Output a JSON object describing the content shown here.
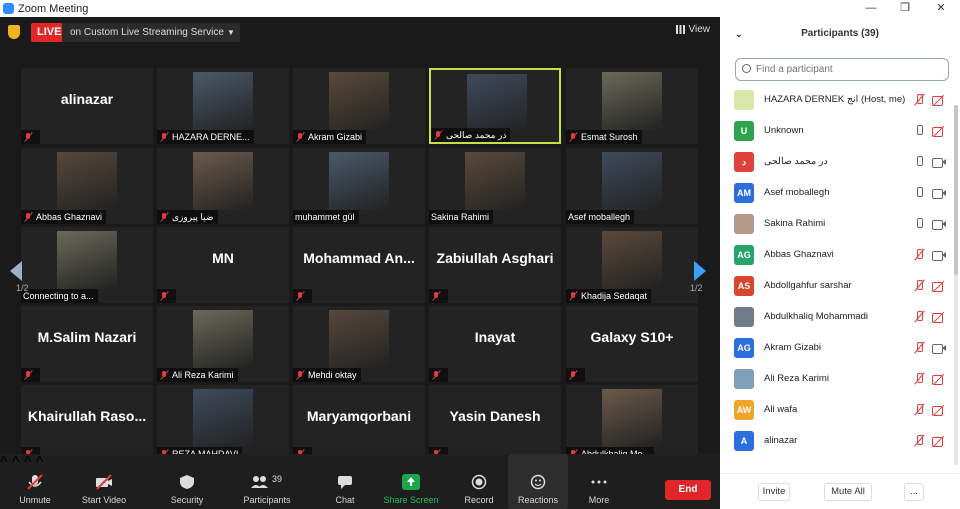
{
  "window": {
    "title": "Zoom Meeting",
    "controls": [
      "—",
      "❐",
      "✕"
    ]
  },
  "topbar": {
    "live_badge": "LIVE",
    "live_service": "on Custom Live Streaming Service",
    "view_label": "View"
  },
  "pages": {
    "left": "1/2",
    "right": "1/2"
  },
  "tiles": [
    {
      "name": "alinazar",
      "type": "text",
      "muted": true
    },
    {
      "name": "HAZARA DERNE...",
      "type": "video",
      "muted": true
    },
    {
      "name": "Akram Gizabi",
      "type": "video",
      "muted": true
    },
    {
      "name": "در محمد صالحی",
      "type": "video",
      "muted": true,
      "active": true
    },
    {
      "name": "Esmat Surosh",
      "type": "video",
      "muted": true
    },
    {
      "name": "Abbas Ghaznavi",
      "type": "video",
      "muted": true
    },
    {
      "name": "ضیا پیروزی",
      "type": "video",
      "muted": true
    },
    {
      "name": "muhammet gül",
      "type": "video",
      "muted": false
    },
    {
      "name": "Sakina Rahimi",
      "type": "video",
      "muted": false
    },
    {
      "name": "Asef moballegh",
      "type": "video",
      "muted": false
    },
    {
      "name": "Connecting to a...",
      "type": "video",
      "muted": false
    },
    {
      "name": "MN",
      "type": "text",
      "muted": true
    },
    {
      "name": "Mohammad  An...",
      "type": "text",
      "muted": true
    },
    {
      "name": "Zabiullah Asghari",
      "type": "text",
      "muted": true
    },
    {
      "name": "Khadija Sedaqat",
      "type": "video",
      "muted": true
    },
    {
      "name": "M.Salim Nazari",
      "type": "text",
      "muted": true
    },
    {
      "name": "Ali Reza Karimi",
      "type": "video",
      "muted": true
    },
    {
      "name": "Mehdi oktay",
      "type": "video",
      "muted": true
    },
    {
      "name": "Inayat",
      "type": "text",
      "muted": true
    },
    {
      "name": "Galaxy S10+",
      "type": "text",
      "muted": true
    },
    {
      "name": "Khairullah  Raso...",
      "type": "text",
      "muted": true
    },
    {
      "name": "REZA MAHDAVI",
      "type": "video",
      "muted": true
    },
    {
      "name": "Maryamqorbani",
      "type": "text",
      "muted": true
    },
    {
      "name": "Yasin Danesh",
      "type": "text",
      "muted": true
    },
    {
      "name": "Abdulkhaliq Mo...",
      "type": "video",
      "muted": true
    }
  ],
  "toolbar": {
    "unmute": "Unmute",
    "start_video": "Start Video",
    "security": "Security",
    "participants": "Participants",
    "participants_count": "39",
    "chat": "Chat",
    "share_screen": "Share Screen",
    "record": "Record",
    "reactions": "Reactions",
    "more": "More",
    "end": "End"
  },
  "panel": {
    "title": "Participants (39)",
    "search_placeholder": "Find a participant",
    "participants": [
      {
        "initials": "",
        "name": "HAZARA DERNEK انج (Host, me)",
        "color": "#dbe7a8",
        "mic": "off",
        "cam": "off"
      },
      {
        "initials": "U",
        "name": "Unknown",
        "color": "#2ea44f",
        "mic": "on",
        "cam": "off"
      },
      {
        "initials": "د",
        "name": "در محمد صالحی",
        "color": "#e0423a",
        "mic": "on",
        "cam": "on"
      },
      {
        "initials": "AM",
        "name": "Asef moballegh",
        "color": "#2a6fdb",
        "mic": "on",
        "cam": "on"
      },
      {
        "initials": "",
        "name": "Sakina Rahimi",
        "color": "#b59a8a",
        "mic": "on",
        "cam": "on"
      },
      {
        "initials": "AG",
        "name": "Abbas Ghaznavi",
        "color": "#27a36b",
        "mic": "off",
        "cam": "on"
      },
      {
        "initials": "AS",
        "name": "Abdollgahfur sarshar",
        "color": "#d9462f",
        "mic": "off",
        "cam": "off"
      },
      {
        "initials": "",
        "name": "Abdulkhaliq Mohammadi",
        "color": "#6f7c8a",
        "mic": "off",
        "cam": "off"
      },
      {
        "initials": "AG",
        "name": "Akram Gizabi",
        "color": "#2a6fdb",
        "mic": "off",
        "cam": "on"
      },
      {
        "initials": "",
        "name": "Ali Reza Karimi",
        "color": "#7ea0b8",
        "mic": "off",
        "cam": "off"
      },
      {
        "initials": "AW",
        "name": "Ali wafa",
        "color": "#f0a42a",
        "mic": "off",
        "cam": "off"
      },
      {
        "initials": "A",
        "name": "alinazar",
        "color": "#2a6fdb",
        "mic": "off",
        "cam": "off"
      }
    ],
    "invite": "Invite",
    "mute_all": "Mute All",
    "more": "..."
  }
}
